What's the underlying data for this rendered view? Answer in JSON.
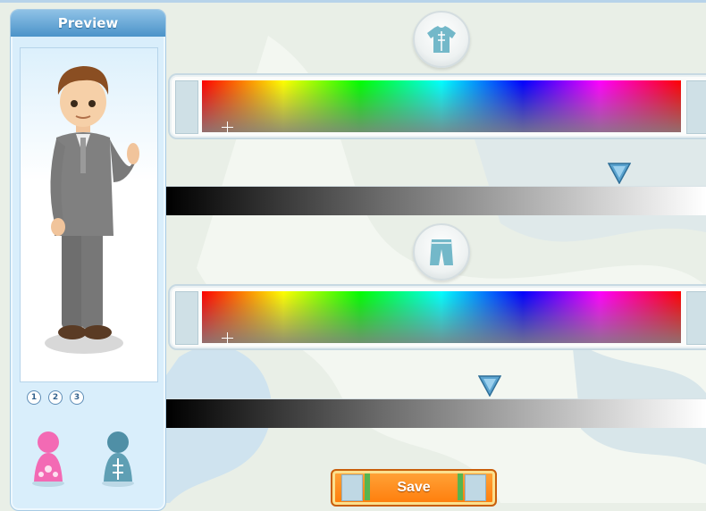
{
  "panel": {
    "title": "Preview",
    "pages": [
      "1",
      "2",
      "3"
    ],
    "gender_icons": [
      "female-avatar-icon",
      "male-avatar-icon"
    ]
  },
  "top_section": {
    "icon": "shirt-icon",
    "palette_cursor": "crosshair",
    "brightness_level": 0.84
  },
  "bottom_section": {
    "icon": "pants-icon",
    "palette_cursor": "crosshair",
    "brightness_level": 0.6
  },
  "colors": {
    "accent_blue": "#4b93c9",
    "save_orange": "#ff7c0a",
    "slider_arrow": "#5aa3cf"
  },
  "save_label": "Save"
}
